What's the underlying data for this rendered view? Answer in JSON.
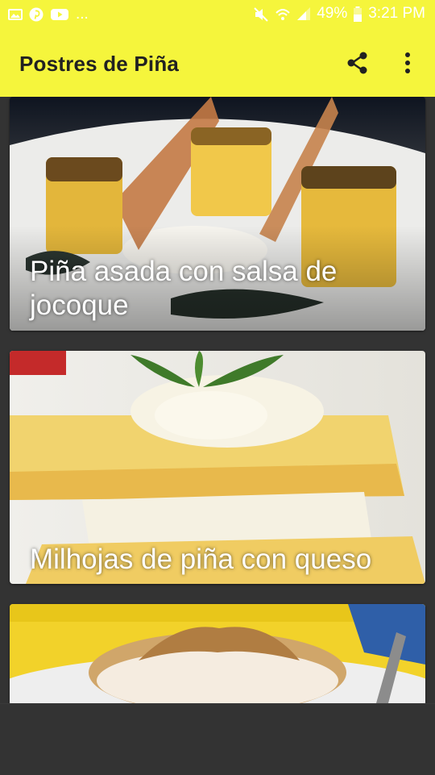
{
  "status_bar": {
    "battery": "49%",
    "time": "3:21 PM",
    "left_icons": [
      "image-icon",
      "pinterest-icon",
      "youtube-icon"
    ],
    "overflow": "...",
    "right_icons": [
      "mute-icon",
      "wifi-icon",
      "signal-icon",
      "battery-icon"
    ]
  },
  "app_bar": {
    "title": "Postres de Piña",
    "actions": [
      "share-icon",
      "more-vert-icon"
    ],
    "background": "#f5f53c"
  },
  "recipes": [
    {
      "title": "Piña asada con salsa de jocoque"
    },
    {
      "title": "Milhojas de piña con queso"
    },
    {
      "title": ""
    }
  ]
}
